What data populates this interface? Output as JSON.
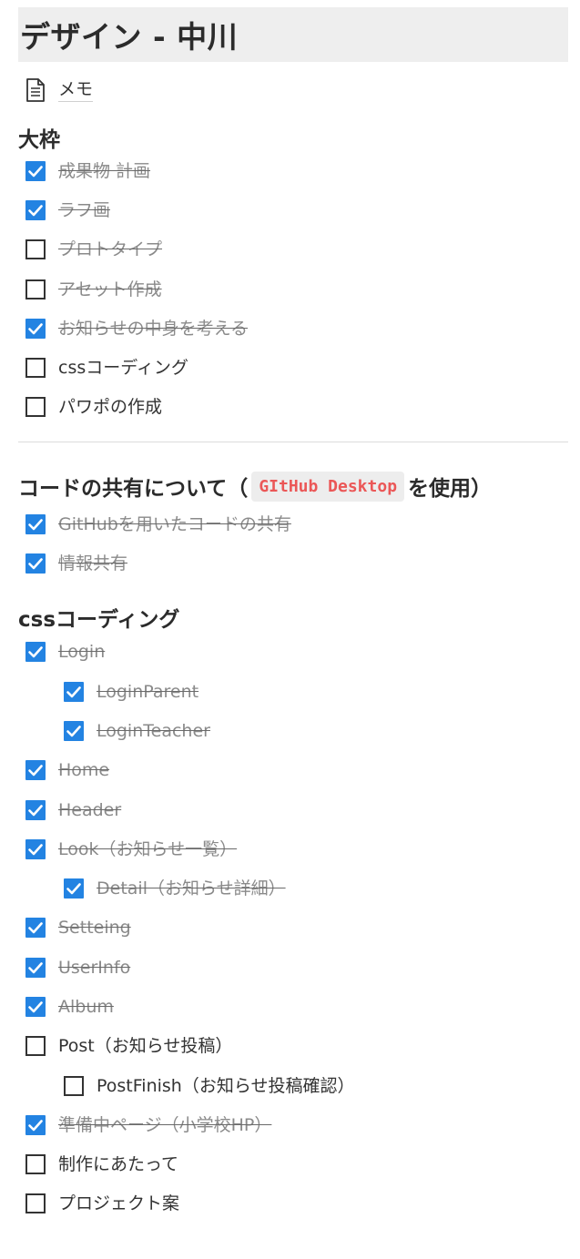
{
  "page": {
    "title": "デザイン - 中川",
    "memo_label": "メモ"
  },
  "sections": {
    "daiwaku": {
      "heading": "大枠",
      "items": [
        {
          "label": "成果物 計画",
          "checked": true,
          "indent": 0
        },
        {
          "label": "ラフ画",
          "checked": true,
          "indent": 0
        },
        {
          "label": "プロトタイプ",
          "checked": false,
          "indent": 0,
          "strike": true
        },
        {
          "label": "アセット作成",
          "checked": false,
          "indent": 0,
          "strike": true
        },
        {
          "label": "お知らせの中身を考える",
          "checked": true,
          "indent": 0
        },
        {
          "label": "cssコーディング",
          "checked": false,
          "indent": 0
        },
        {
          "label": "パワポの作成",
          "checked": false,
          "indent": 0
        }
      ]
    },
    "code_sharing": {
      "heading_prefix": "コードの共有について（",
      "heading_code": "GItHub Desktop",
      "heading_suffix": "を使用）",
      "items": [
        {
          "label": "GitHubを用いたコードの共有",
          "checked": true,
          "indent": 0
        },
        {
          "label": "情報共有",
          "checked": true,
          "indent": 0
        }
      ]
    },
    "css_coding": {
      "heading": "cssコーディング",
      "items": [
        {
          "label": "Login",
          "checked": true,
          "indent": 0
        },
        {
          "label": "LoginParent",
          "checked": true,
          "indent": 1
        },
        {
          "label": "LoginTeacher",
          "checked": true,
          "indent": 1
        },
        {
          "label": "Home",
          "checked": true,
          "indent": 0
        },
        {
          "label": "Header",
          "checked": true,
          "indent": 0
        },
        {
          "label": "Look（お知らせ一覧）",
          "checked": true,
          "indent": 0
        },
        {
          "label": "Detail（お知らせ詳細）",
          "checked": true,
          "indent": 1
        },
        {
          "label": "Setteing",
          "checked": true,
          "indent": 0
        },
        {
          "label": "UserInfo",
          "checked": true,
          "indent": 0
        },
        {
          "label": "Album",
          "checked": true,
          "indent": 0
        },
        {
          "label": "Post（お知らせ投稿）",
          "checked": false,
          "indent": 0
        },
        {
          "label": "PostFinish（お知らせ投稿確認）",
          "checked": false,
          "indent": 1
        },
        {
          "label": "準備中ページ（小学校HP）",
          "checked": true,
          "indent": 0
        },
        {
          "label": "制作にあたって",
          "checked": false,
          "indent": 0
        },
        {
          "label": "プロジェクト案",
          "checked": false,
          "indent": 0
        }
      ]
    }
  },
  "colors": {
    "checkbox_checked": "#2383e2",
    "done_text": "#8a8a8a",
    "code_text": "#eb5757",
    "title_bg": "#eeeeee"
  }
}
